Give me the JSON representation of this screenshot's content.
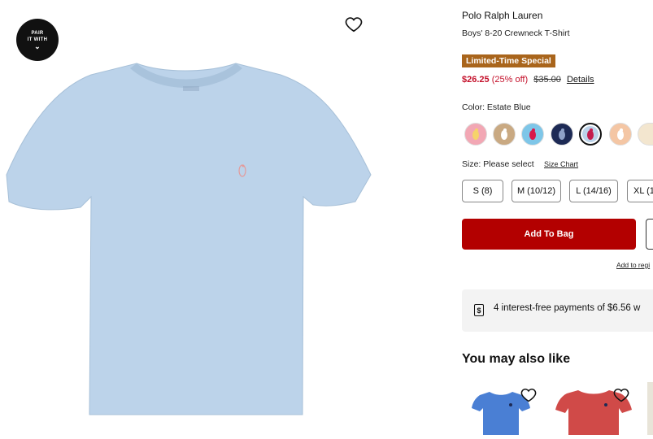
{
  "badge": {
    "line1": "PAIR",
    "line2": "IT WITH",
    "chevron": "⌄"
  },
  "product": {
    "brand": "Polo Ralph Lauren",
    "title": "Boys' 8-20 Crewneck T-Shirt",
    "promo": "Limited-Time Special",
    "sale_price": "$26.25",
    "discount": "(25% off)",
    "original_price": "$35.00",
    "details_link": "Details",
    "color_label": "Color: Estate Blue",
    "swatches": [
      {
        "name": "pink",
        "color": "#f2a7b4",
        "selected": false
      },
      {
        "name": "tan",
        "color": "#c9a982",
        "selected": false
      },
      {
        "name": "light-blue-pink-pony",
        "color": "#7ec6e8",
        "selected": false
      },
      {
        "name": "navy",
        "color": "#1d2a55",
        "selected": false
      },
      {
        "name": "estate-blue",
        "color": "#bcd3ea",
        "selected": true
      },
      {
        "name": "peach",
        "color": "#f4c6a4",
        "selected": false
      },
      {
        "name": "cream",
        "color": "#f3e6cf",
        "selected": false
      }
    ],
    "size_label": "Size: Please select",
    "size_chart": "Size Chart",
    "sizes": [
      "S (8)",
      "M (10/12)",
      "L (14/16)",
      "XL (1"
    ],
    "add_to_bag": "Add To Bag",
    "registry": "Add to regi",
    "installments": "4 interest-free payments of $6.56 w"
  },
  "recommendations": {
    "heading": "You may also like"
  },
  "colors": {
    "accent_red": "#b30000",
    "sale_red": "#c4102a",
    "promo_bg": "#a9651c",
    "shirt_blue": "#bcd3ea"
  }
}
